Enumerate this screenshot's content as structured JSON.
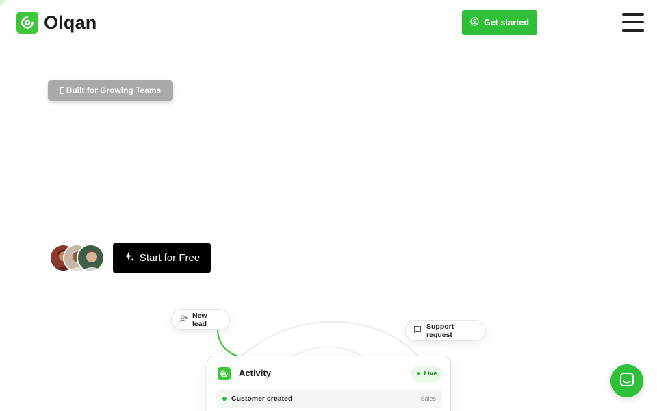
{
  "header": {
    "brand": "Olqan",
    "cta_label": "Get started"
  },
  "hero": {
    "badge_label": "Built for Growing Teams",
    "start_button_label": "Start for Free"
  },
  "illustration": {
    "new_lead_label": "New lead",
    "support_label": "Support request",
    "card_title": "Activity",
    "live_label": "Live",
    "event": {
      "label": "Customer created",
      "tag": "Sales"
    }
  },
  "colors": {
    "brand_green": "#3ec63a",
    "cta_green": "#2fbf38",
    "dark": "#000000"
  },
  "icons": [
    "logo-icon",
    "user-circle-icon",
    "menu-icon",
    "sparkle-icon",
    "user-plus-icon",
    "message-icon",
    "chat-icon"
  ]
}
